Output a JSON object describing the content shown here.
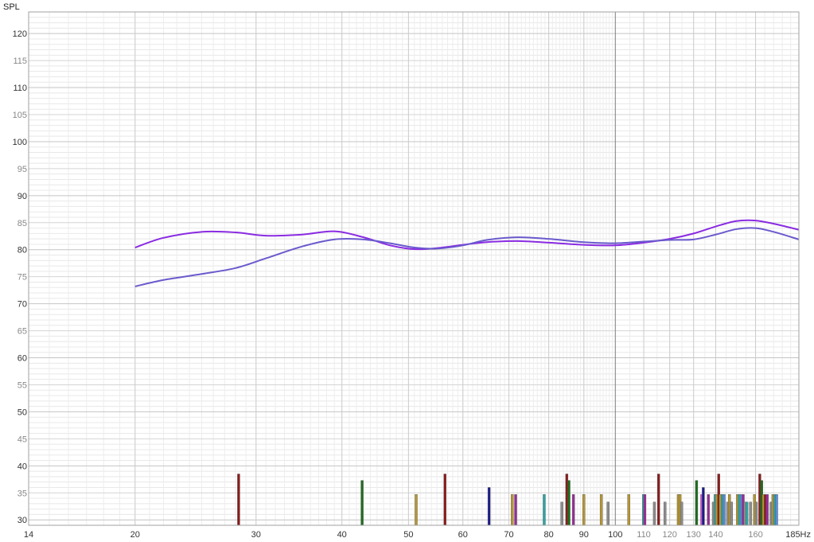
{
  "chart_data": {
    "type": "line",
    "title": "",
    "ylabel": "SPL",
    "xunit": "Hz",
    "xscale": "log",
    "xlim": [
      14,
      185
    ],
    "ylim": [
      29,
      124
    ],
    "grid": true,
    "x_ticks": [
      {
        "value": 14,
        "label": "14",
        "emph": true
      },
      {
        "value": 20,
        "label": "20",
        "emph": true
      },
      {
        "value": 30,
        "label": "30",
        "emph": true
      },
      {
        "value": 40,
        "label": "40",
        "emph": true
      },
      {
        "value": 50,
        "label": "50",
        "emph": true
      },
      {
        "value": 60,
        "label": "60",
        "emph": true
      },
      {
        "value": 70,
        "label": "70",
        "emph": true
      },
      {
        "value": 80,
        "label": "80",
        "emph": true
      },
      {
        "value": 90,
        "label": "90",
        "emph": true
      },
      {
        "value": 100,
        "label": "100",
        "emph": true
      },
      {
        "value": 110,
        "label": "110",
        "emph": false
      },
      {
        "value": 120,
        "label": "120",
        "emph": false
      },
      {
        "value": 130,
        "label": "130",
        "emph": false
      },
      {
        "value": 140,
        "label": "140",
        "emph": false
      },
      {
        "value": 160,
        "label": "160",
        "emph": false
      },
      {
        "value": 185,
        "label": "185Hz",
        "emph": true
      }
    ],
    "y_ticks": [
      {
        "value": 30,
        "label": "30",
        "emph": true
      },
      {
        "value": 35,
        "label": "35",
        "emph": false
      },
      {
        "value": 40,
        "label": "40",
        "emph": true
      },
      {
        "value": 45,
        "label": "45",
        "emph": false
      },
      {
        "value": 50,
        "label": "50",
        "emph": true
      },
      {
        "value": 55,
        "label": "55",
        "emph": false
      },
      {
        "value": 60,
        "label": "60",
        "emph": true
      },
      {
        "value": 65,
        "label": "65",
        "emph": false
      },
      {
        "value": 70,
        "label": "70",
        "emph": true
      },
      {
        "value": 75,
        "label": "75",
        "emph": false
      },
      {
        "value": 80,
        "label": "80",
        "emph": true
      },
      {
        "value": 85,
        "label": "85",
        "emph": false
      },
      {
        "value": 90,
        "label": "90",
        "emph": true
      },
      {
        "value": 95,
        "label": "95",
        "emph": false
      },
      {
        "value": 100,
        "label": "100",
        "emph": true
      },
      {
        "value": 105,
        "label": "105",
        "emph": false
      },
      {
        "value": 110,
        "label": "110",
        "emph": true
      },
      {
        "value": 115,
        "label": "115",
        "emph": false
      },
      {
        "value": 120,
        "label": "120",
        "emph": true
      }
    ],
    "series": [
      {
        "color": "#8a2be2",
        "x": [
          20,
          22,
          25,
          28,
          31,
          35,
          39,
          43,
          47,
          51,
          55,
          60,
          65,
          72,
          80,
          90,
          100,
          110,
          120,
          130,
          140,
          150,
          160,
          170,
          185
        ],
        "y": [
          80.4,
          82.2,
          83.3,
          83.2,
          82.6,
          82.8,
          83.4,
          82.3,
          80.8,
          80.1,
          80.3,
          80.9,
          81.4,
          81.6,
          81.3,
          80.9,
          80.8,
          81.3,
          82.0,
          83.0,
          84.3,
          85.3,
          85.4,
          84.8,
          83.7
        ]
      },
      {
        "color": "#6a5acd",
        "x": [
          20,
          22,
          25,
          28,
          31,
          35,
          39,
          43,
          47,
          51,
          55,
          60,
          65,
          72,
          80,
          90,
          100,
          110,
          120,
          130,
          140,
          150,
          160,
          170,
          185
        ],
        "y": [
          73.2,
          74.4,
          75.5,
          76.6,
          78.4,
          80.6,
          81.9,
          81.9,
          81.2,
          80.4,
          80.2,
          80.8,
          81.8,
          82.3,
          82.0,
          81.4,
          81.2,
          81.5,
          81.8,
          81.9,
          82.8,
          83.8,
          84.0,
          83.3,
          81.9
        ]
      }
    ],
    "bars": [
      {
        "x": 28.3,
        "top": 38.5,
        "color": "#8b1a1a"
      },
      {
        "x": 42.8,
        "top": 37.3,
        "color": "#1a6e1a"
      },
      {
        "x": 51.3,
        "top": 34.7,
        "color": "#b8962e"
      },
      {
        "x": 56.5,
        "top": 38.5,
        "color": "#8b1a1a"
      },
      {
        "x": 65.5,
        "top": 36.0,
        "color": "#1a1a8b"
      },
      {
        "x": 70.8,
        "top": 34.7,
        "color": "#b8962e"
      },
      {
        "x": 71.6,
        "top": 34.7,
        "color": "#9a2a9a"
      },
      {
        "x": 78.8,
        "top": 34.7,
        "color": "#2aa6a6"
      },
      {
        "x": 83.6,
        "top": 33.3,
        "color": "#8c8c8c"
      },
      {
        "x": 85.0,
        "top": 38.5,
        "color": "#8b1a1a"
      },
      {
        "x": 85.6,
        "top": 37.3,
        "color": "#1a6e1a"
      },
      {
        "x": 86.9,
        "top": 34.7,
        "color": "#9a2a9a"
      },
      {
        "x": 90.0,
        "top": 34.7,
        "color": "#b8962e"
      },
      {
        "x": 95.4,
        "top": 34.7,
        "color": "#b8962e"
      },
      {
        "x": 97.6,
        "top": 33.3,
        "color": "#8c8c8c"
      },
      {
        "x": 104.6,
        "top": 34.7,
        "color": "#b8962e"
      },
      {
        "x": 109.9,
        "top": 34.7,
        "color": "#2aa6a6"
      },
      {
        "x": 110.4,
        "top": 34.7,
        "color": "#9a2a9a"
      },
      {
        "x": 114.0,
        "top": 33.3,
        "color": "#8c8c8c"
      },
      {
        "x": 115.6,
        "top": 38.5,
        "color": "#8b1a1a"
      },
      {
        "x": 118.1,
        "top": 33.3,
        "color": "#8c8c8c"
      },
      {
        "x": 123.5,
        "top": 34.7,
        "color": "#b8962e"
      },
      {
        "x": 124.2,
        "top": 34.7,
        "color": "#b8962e"
      },
      {
        "x": 124.9,
        "top": 33.3,
        "color": "#8c8c8c"
      },
      {
        "x": 131.3,
        "top": 37.3,
        "color": "#1a6e1a"
      },
      {
        "x": 133.6,
        "top": 34.7,
        "color": "#d24fd2"
      },
      {
        "x": 134.3,
        "top": 36.0,
        "color": "#1a1a8b"
      },
      {
        "x": 136.6,
        "top": 34.7,
        "color": "#9a2a9a"
      },
      {
        "x": 138.9,
        "top": 33.3,
        "color": "#8c8c8c"
      },
      {
        "x": 139.7,
        "top": 34.7,
        "color": "#2aa6a6"
      },
      {
        "x": 140.5,
        "top": 34.7,
        "color": "#b8962e"
      },
      {
        "x": 141.4,
        "top": 38.5,
        "color": "#8b1a1a"
      },
      {
        "x": 142.2,
        "top": 34.7,
        "color": "#b8962e"
      },
      {
        "x": 143.1,
        "top": 34.7,
        "color": "#2aa6a6"
      },
      {
        "x": 144.0,
        "top": 34.7,
        "color": "#5a8ad8"
      },
      {
        "x": 145.7,
        "top": 33.3,
        "color": "#8c8c8c"
      },
      {
        "x": 146.6,
        "top": 34.7,
        "color": "#b8962e"
      },
      {
        "x": 147.6,
        "top": 33.3,
        "color": "#8c8c8c"
      },
      {
        "x": 150.6,
        "top": 34.7,
        "color": "#b8962e"
      },
      {
        "x": 151.5,
        "top": 34.7,
        "color": "#2aa6a6"
      },
      {
        "x": 152.5,
        "top": 34.7,
        "color": "#5a8ad8"
      },
      {
        "x": 153.5,
        "top": 34.7,
        "color": "#9a2a9a"
      },
      {
        "x": 154.4,
        "top": 33.3,
        "color": "#8c8c8c"
      },
      {
        "x": 155.4,
        "top": 33.3,
        "color": "#2aa6a6"
      },
      {
        "x": 157.3,
        "top": 33.3,
        "color": "#8c8c8c"
      },
      {
        "x": 159.4,
        "top": 34.7,
        "color": "#b8962e"
      },
      {
        "x": 160.4,
        "top": 33.3,
        "color": "#8c8c8c"
      },
      {
        "x": 162.3,
        "top": 38.5,
        "color": "#8b1a1a"
      },
      {
        "x": 163.3,
        "top": 37.3,
        "color": "#1a6e1a"
      },
      {
        "x": 164.3,
        "top": 34.7,
        "color": "#b8962e"
      },
      {
        "x": 165.3,
        "top": 34.7,
        "color": "#8b1a1a"
      },
      {
        "x": 166.4,
        "top": 34.7,
        "color": "#9a2a9a"
      },
      {
        "x": 168.5,
        "top": 33.3,
        "color": "#8c8c8c"
      },
      {
        "x": 169.6,
        "top": 34.7,
        "color": "#b8962e"
      },
      {
        "x": 170.6,
        "top": 34.7,
        "color": "#2aa6a6"
      },
      {
        "x": 171.7,
        "top": 34.7,
        "color": "#5a8ad8"
      }
    ]
  }
}
